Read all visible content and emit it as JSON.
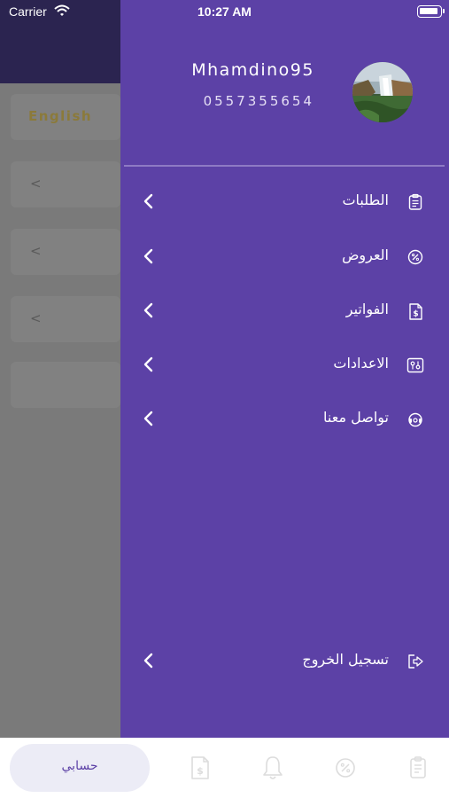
{
  "status_bar": {
    "carrier": "Carrier",
    "time": "10:27 AM"
  },
  "background_screen": {
    "language_label": "English",
    "chevron": "<"
  },
  "drawer": {
    "username": "Mhamdino95",
    "phone": "0557355654",
    "menu": [
      {
        "label": "الطلبات",
        "icon": "clipboard-icon"
      },
      {
        "label": "العروض",
        "icon": "percent-icon"
      },
      {
        "label": "الفواتير",
        "icon": "invoice-icon"
      },
      {
        "label": "الاعدادات",
        "icon": "settings-icon"
      },
      {
        "label": "تواصل معنا",
        "icon": "support-icon"
      }
    ],
    "logout": {
      "label": "تسجيل الخروج",
      "icon": "logout-icon"
    }
  },
  "tab_bar": {
    "account_label": "حسابي",
    "tabs": [
      "invoice-icon",
      "bell-icon",
      "percent-icon",
      "clipboard-icon"
    ]
  },
  "colors": {
    "drawer_bg": "#5c41a6",
    "overlay": "#7a7a7a",
    "header_dark": "#2b2450",
    "accent": "#5c41a6",
    "tab_icon": "#dcdcdc"
  }
}
